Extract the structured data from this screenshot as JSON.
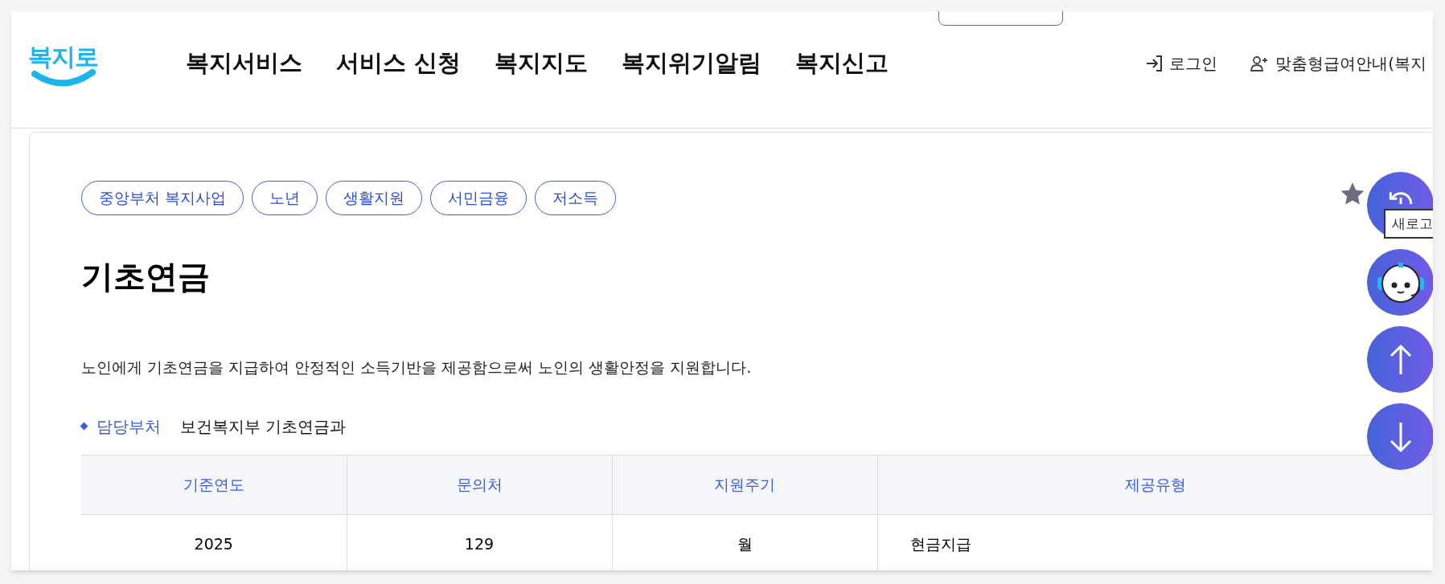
{
  "header": {
    "logo": "복지로",
    "nav": [
      {
        "label": "복지서비스"
      },
      {
        "label": "서비스 신청"
      },
      {
        "label": "복지지도"
      },
      {
        "label": "복지위기알림"
      },
      {
        "label": "복지신고"
      }
    ],
    "login": "로그인",
    "guide": "맞춤형급여안내(복지"
  },
  "tags": [
    "중앙부처 복지사업",
    "노년",
    "생활지원",
    "서민금융",
    "저소득"
  ],
  "title": "기초연금",
  "description": "노인에게 기초연금을 지급하여 안정적인 소득기반을 제공함으로써 노인의 생활안정을 지원합니다.",
  "department": {
    "label": "담당부처",
    "value": "보건복지부 기초연금과"
  },
  "table": {
    "columns": [
      "기준연도",
      "문의처",
      "지원주기",
      "제공유형"
    ],
    "rows": [
      [
        "2025",
        "129",
        "월",
        "현금지급"
      ]
    ]
  },
  "floating": {
    "tooltip": "새로고"
  }
}
